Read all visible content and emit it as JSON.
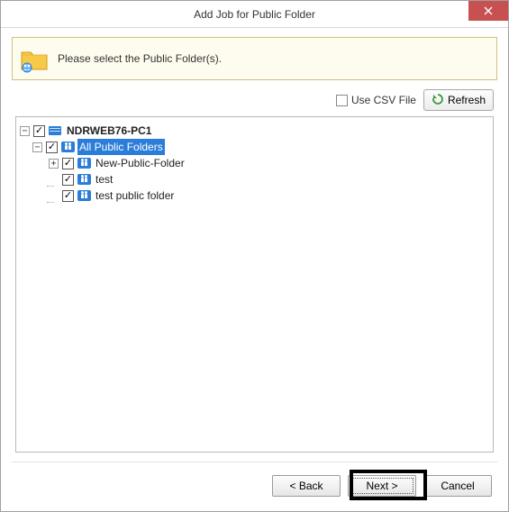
{
  "window": {
    "title": "Add Job for Public Folder"
  },
  "prompt": {
    "text": "Please select the Public Folder(s)."
  },
  "toolbar": {
    "use_csv_label": "Use CSV File",
    "refresh_label": "Refresh"
  },
  "tree": {
    "root": {
      "label": "NDRWEB76-PC1",
      "expanded": true,
      "checked": true
    },
    "all_public": {
      "label": "All Public Folders",
      "expanded": true,
      "checked": true,
      "selected": true
    },
    "children": [
      {
        "label": "New-Public-Folder",
        "checked": true,
        "expandable": true
      },
      {
        "label": "test",
        "checked": true,
        "expandable": false
      },
      {
        "label": "test public folder",
        "checked": true,
        "expandable": false
      }
    ]
  },
  "buttons": {
    "back": "< Back",
    "next": "Next >",
    "cancel": "Cancel"
  }
}
